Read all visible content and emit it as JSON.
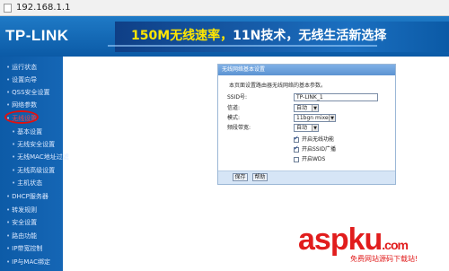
{
  "browser": {
    "url": "192.168.1.1"
  },
  "banner": {
    "logo": "TP-LINK",
    "slogan_highlight": "150M无线速率，",
    "slogan_rest": "11N技术，无线生活新选择"
  },
  "sidebar": {
    "items": [
      {
        "label": "运行状态",
        "sub": false,
        "active": false
      },
      {
        "label": "设置向导",
        "sub": false,
        "active": false
      },
      {
        "label": "QSS安全设置",
        "sub": false,
        "active": false
      },
      {
        "label": "网络参数",
        "sub": false,
        "active": false
      },
      {
        "label": "无线设置",
        "sub": false,
        "active": true
      },
      {
        "label": "基本设置",
        "sub": true,
        "active": false
      },
      {
        "label": "无线安全设置",
        "sub": true,
        "active": false
      },
      {
        "label": "无线MAC地址过滤",
        "sub": true,
        "active": false
      },
      {
        "label": "无线高级设置",
        "sub": true,
        "active": false
      },
      {
        "label": "主机状态",
        "sub": true,
        "active": false
      },
      {
        "label": "DHCP服务器",
        "sub": false,
        "active": false
      },
      {
        "label": "转发规则",
        "sub": false,
        "active": false
      },
      {
        "label": "安全设置",
        "sub": false,
        "active": false
      },
      {
        "label": "路由功能",
        "sub": false,
        "active": false
      },
      {
        "label": "IP带宽控制",
        "sub": false,
        "active": false
      },
      {
        "label": "IP与MAC绑定",
        "sub": false,
        "active": false
      }
    ]
  },
  "panel": {
    "title": "无线网络基本设置",
    "description": "本页面设置路由器无线网络的基本参数。",
    "fields": {
      "ssid_label": "SSID号:",
      "ssid_value": "TP-LINK_1",
      "channel_label": "信道:",
      "channel_value": "自动",
      "mode_label": "模式:",
      "mode_value": "11bgn mixed",
      "bandwidth_label": "频段带宽:",
      "bandwidth_value": "自动"
    },
    "checkboxes": [
      {
        "label": "开启无线功能",
        "checked": true
      },
      {
        "label": "开启SSID广播",
        "checked": true
      },
      {
        "label": "开启WDS",
        "checked": false
      }
    ],
    "buttons": {
      "save": "保存",
      "help": "帮助"
    }
  },
  "watermark": {
    "main": "aspku",
    "suffix": ".com",
    "tagline": "免费网站源码下载站!"
  }
}
